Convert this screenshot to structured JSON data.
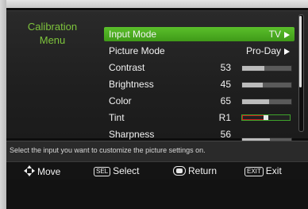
{
  "sidebar": {
    "title_line1": "Calibration",
    "title_line2": "Menu"
  },
  "menu": {
    "items": [
      {
        "label": "Input Mode",
        "value": "TV",
        "has_arrow": true,
        "selected": true
      },
      {
        "label": "Picture Mode",
        "value": "Pro-Day",
        "has_arrow": true
      },
      {
        "label": "Contrast",
        "value": "53",
        "level": 0.45
      },
      {
        "label": "Brightness",
        "value": "45",
        "level": 0.42
      },
      {
        "label": "Color",
        "value": "65",
        "level": 0.55
      },
      {
        "label": "Tint",
        "value": "R1"
      },
      {
        "label": "Sharpness",
        "value": "56",
        "level": 0.55
      }
    ]
  },
  "info": {
    "text": "Select the input you want to customize the picture settings on."
  },
  "footer": {
    "move_label": "Move",
    "sel_key": "SEL",
    "select_label": "Select",
    "return_label": "Return",
    "exit_key": "EXIT",
    "exit_label": "Exit"
  },
  "colors": {
    "accent_green": "#5bbf2b",
    "title_green": "#7ec43c",
    "tint_red": "#d01c1c"
  }
}
